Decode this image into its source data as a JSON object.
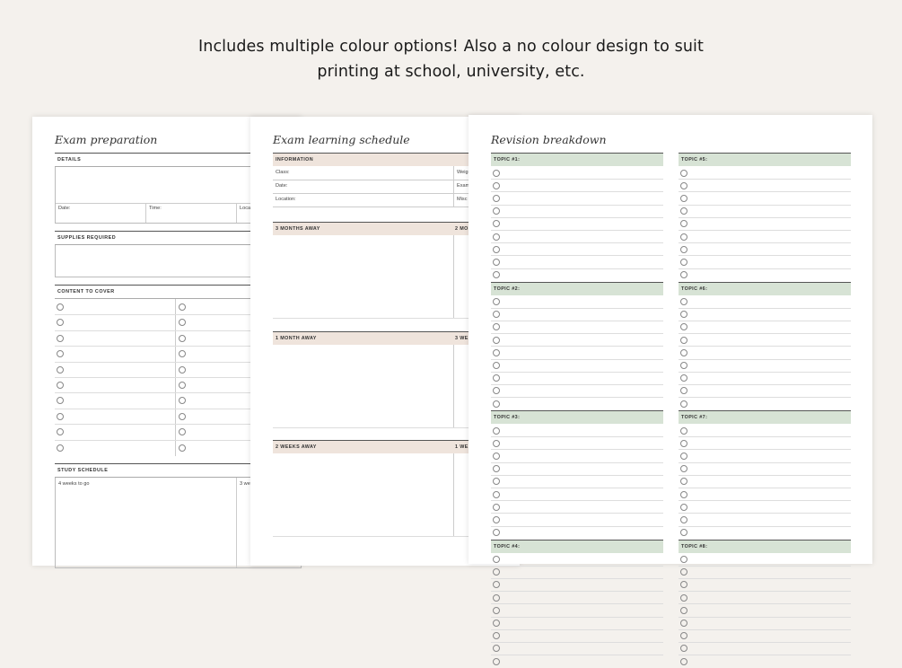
{
  "headline": {
    "line1": "Includes multiple colour options! Also a no colour design to suit",
    "line2": "printing at school, university, etc."
  },
  "exam_prep": {
    "title": "Exam preparation",
    "details_label": "DETAILS",
    "date_label": "Date:",
    "time_label": "Time:",
    "location_label": "Loca",
    "supplies_label": "SUPPLIES REQUIRED",
    "content_label": "CONTENT TO COVER",
    "study_label": "STUDY SCHEDULE",
    "study_col1": "4 weeks to go",
    "study_col2": "3 we"
  },
  "learning_schedule": {
    "title": "Exam learning schedule",
    "info_label": "INFORMATION",
    "fields": [
      "Class:",
      "Date:",
      "Location:"
    ],
    "fields_right": [
      "Weig",
      "Exam",
      "Misc"
    ],
    "periods": [
      {
        "label": "3 MONTHS AWAY",
        "right": "2 MO"
      },
      {
        "label": "1 MONTH AWAY",
        "right": "3 WE"
      },
      {
        "label": "2 WEEKS AWAY",
        "right": "1 WE"
      }
    ]
  },
  "revision": {
    "title": "Revision breakdown",
    "topics_left": [
      "TOPIC #1:",
      "TOPIC #2:",
      "TOPIC #3:",
      "TOPIC #4:"
    ],
    "topics_right": [
      "TOPIC #5:",
      "TOPIC #6:",
      "TOPIC #7:",
      "TOPIC #8:"
    ]
  },
  "colors": {
    "background": "#f4f1ed",
    "beige_accent": "#efe4dc",
    "green_accent": "#d7e3d5"
  }
}
